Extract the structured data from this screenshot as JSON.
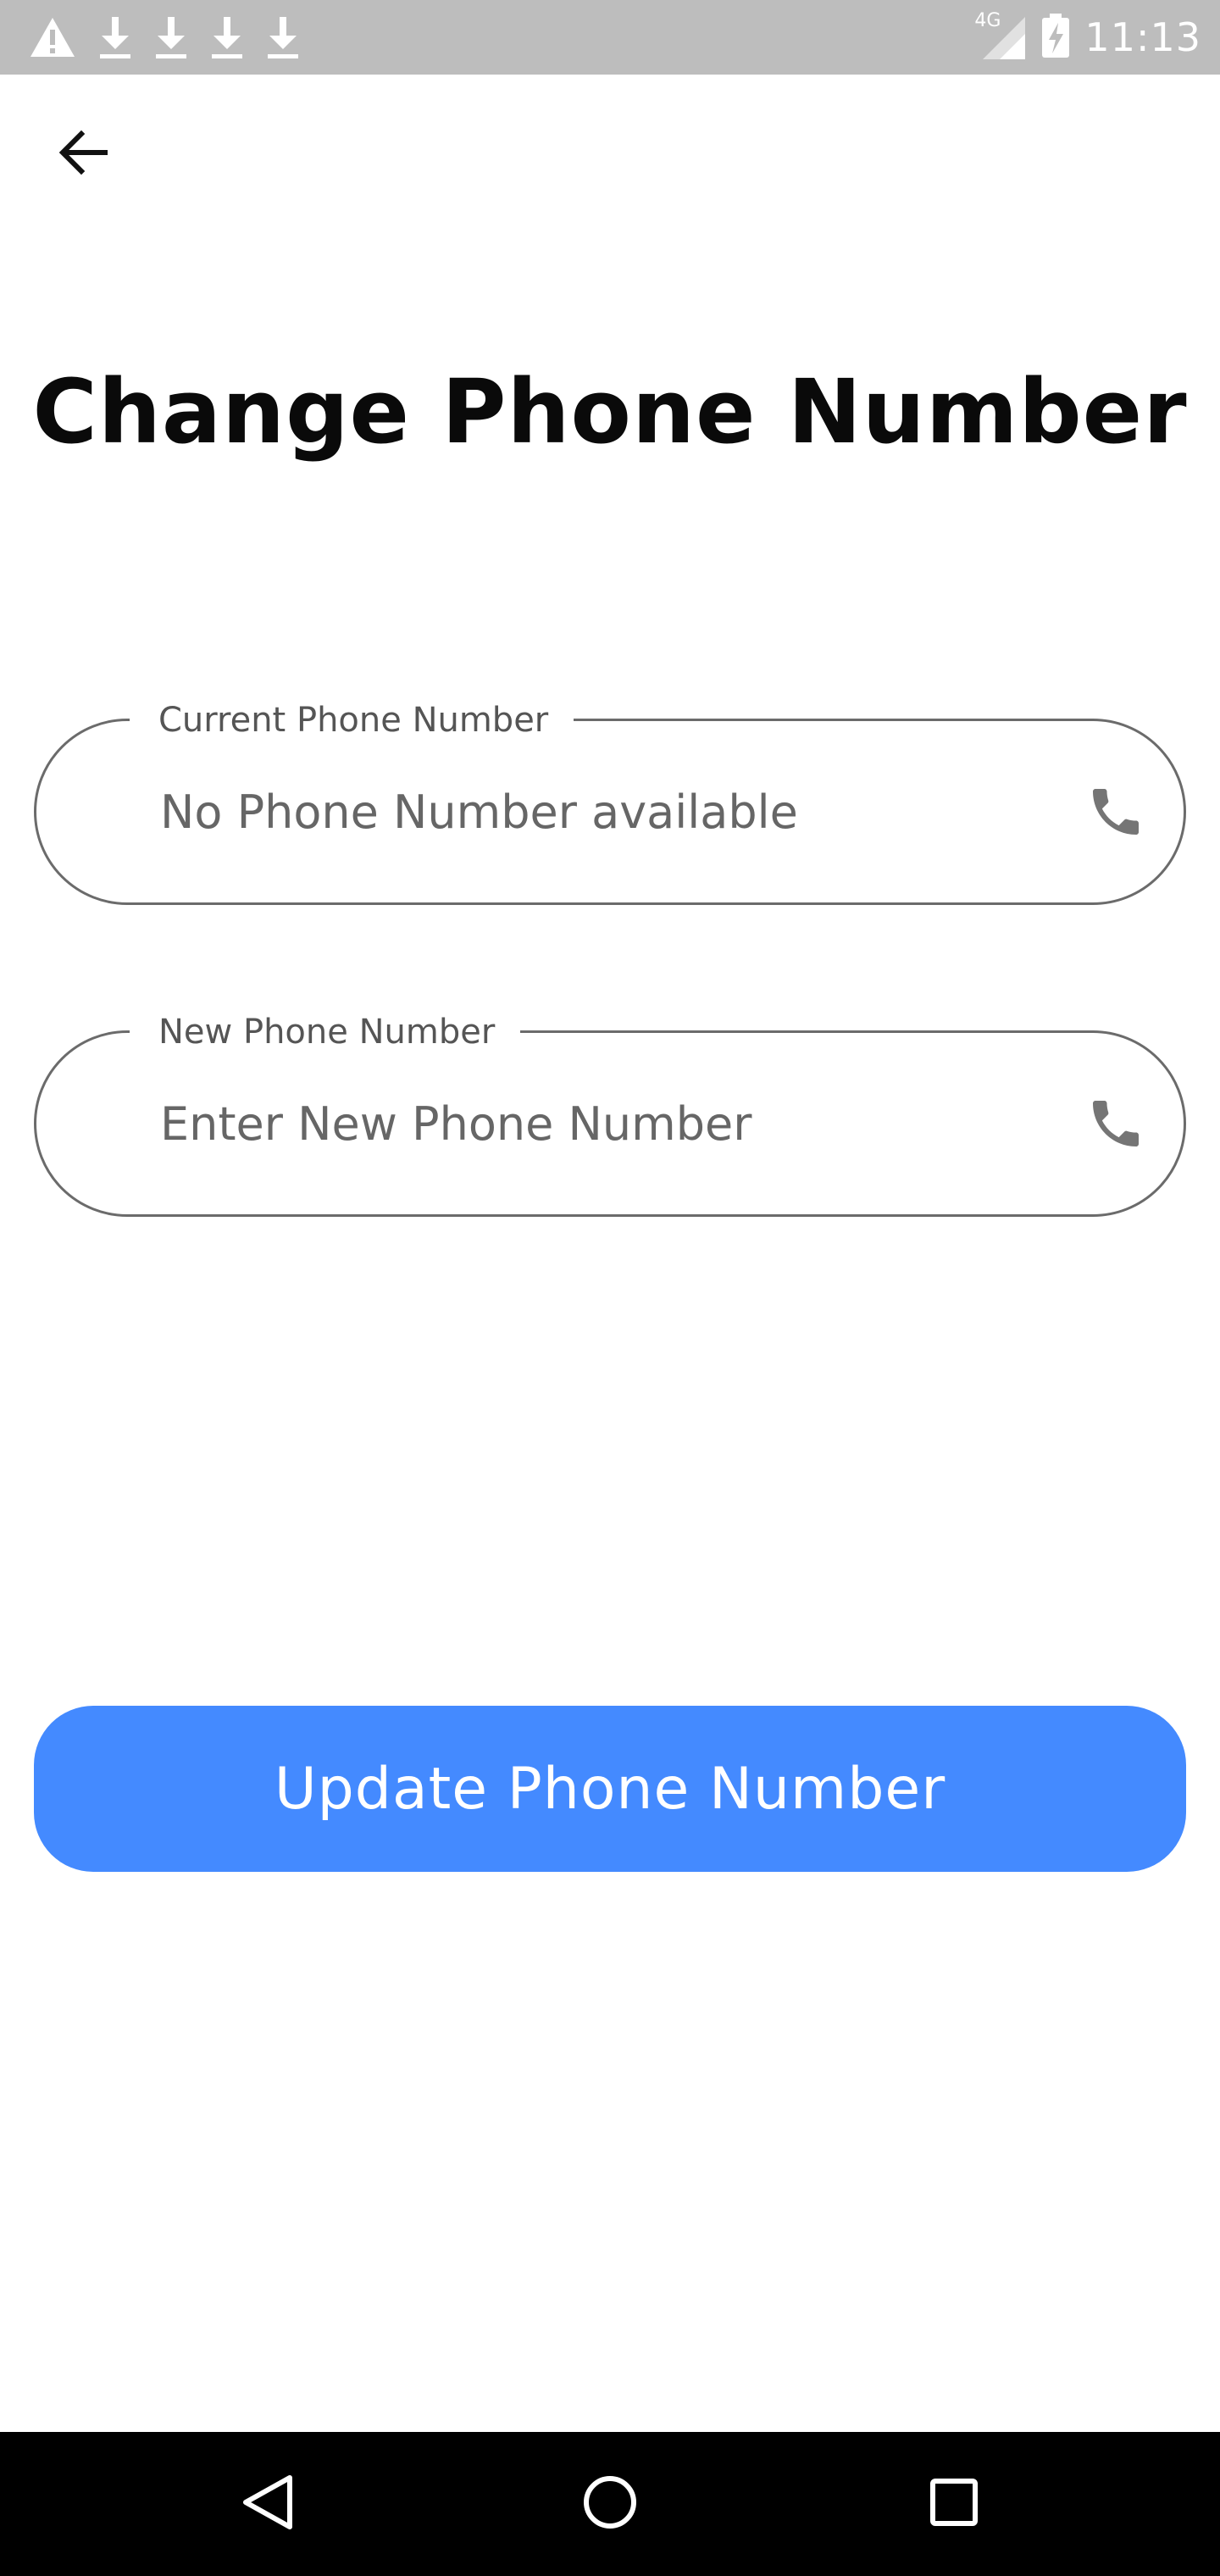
{
  "status_bar": {
    "icons": [
      "warning-icon",
      "download-icon",
      "download-icon",
      "download-icon",
      "download-icon"
    ],
    "network": "4G",
    "time": "11:13"
  },
  "header": {
    "back_icon": "arrow-back-icon"
  },
  "page": {
    "title": "Change Phone Number"
  },
  "fields": {
    "current": {
      "label": "Current Phone Number",
      "value": "No Phone Number available",
      "icon": "phone-icon"
    },
    "new": {
      "label": "New Phone Number",
      "placeholder": "Enter New Phone Number",
      "icon": "phone-icon"
    }
  },
  "actions": {
    "update_label": "Update Phone Number"
  },
  "colors": {
    "accent": "#448aff",
    "status_bar": "#bdbdbd",
    "nav_bar": "#000000"
  }
}
